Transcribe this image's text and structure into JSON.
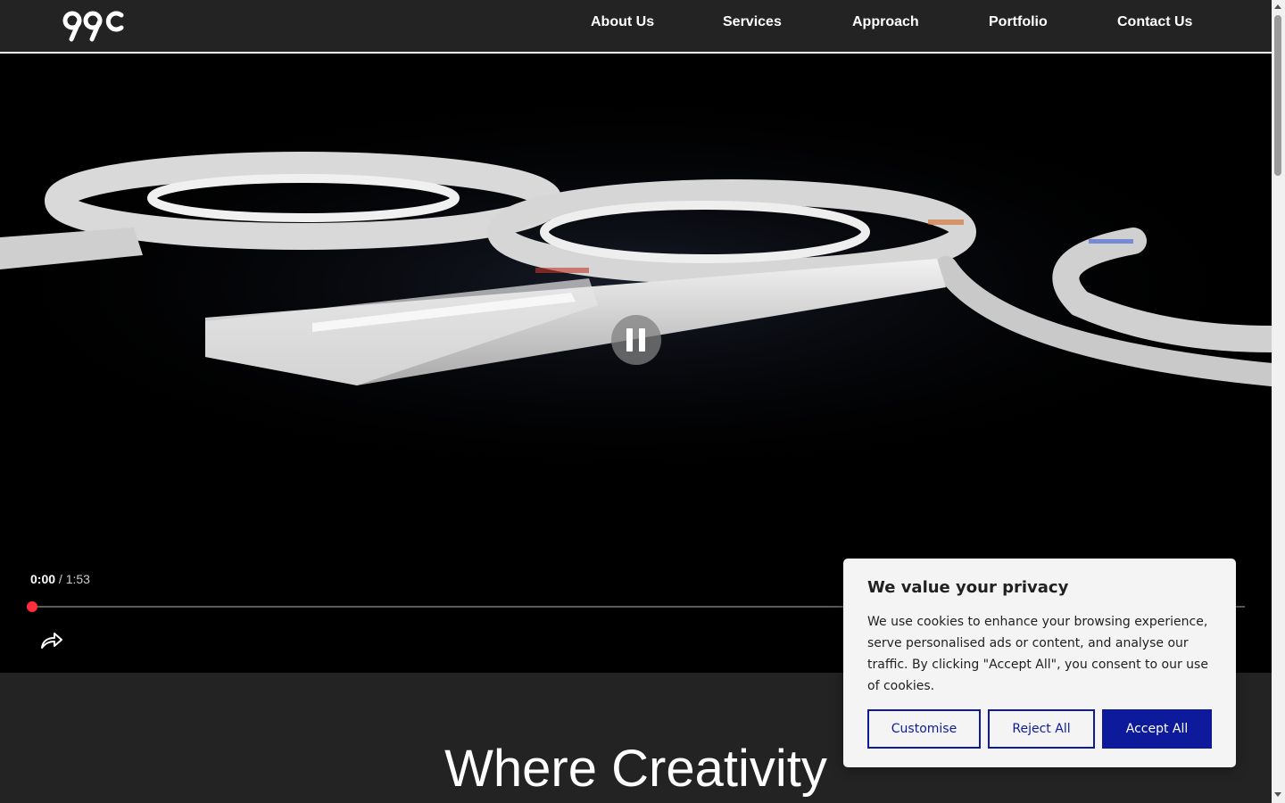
{
  "header": {
    "logo_text": "99c",
    "nav": [
      {
        "label": "About Us"
      },
      {
        "label": "Services"
      },
      {
        "label": "Approach"
      },
      {
        "label": "Portfolio"
      },
      {
        "label": "Contact Us"
      }
    ]
  },
  "video": {
    "current_time": "0:00",
    "separator": "/",
    "duration": "1:53",
    "progress": 0.0,
    "state_icon": "pause-icon",
    "share_icon": "share-icon"
  },
  "hero": {
    "title": "Where Creativity"
  },
  "cookie": {
    "title": "We value your privacy",
    "text": "We use cookies to enhance your browsing experience, serve personalised ads or content, and analyse our traffic. By clicking \"Accept All\", you consent to our use of cookies.",
    "customise_label": "Customise",
    "reject_label": "Reject All",
    "accept_label": "Accept All"
  },
  "colors": {
    "header_bg": "#232323",
    "progress_red": "#ff2d3c",
    "cookie_button_blue": "#0d1a9c"
  }
}
